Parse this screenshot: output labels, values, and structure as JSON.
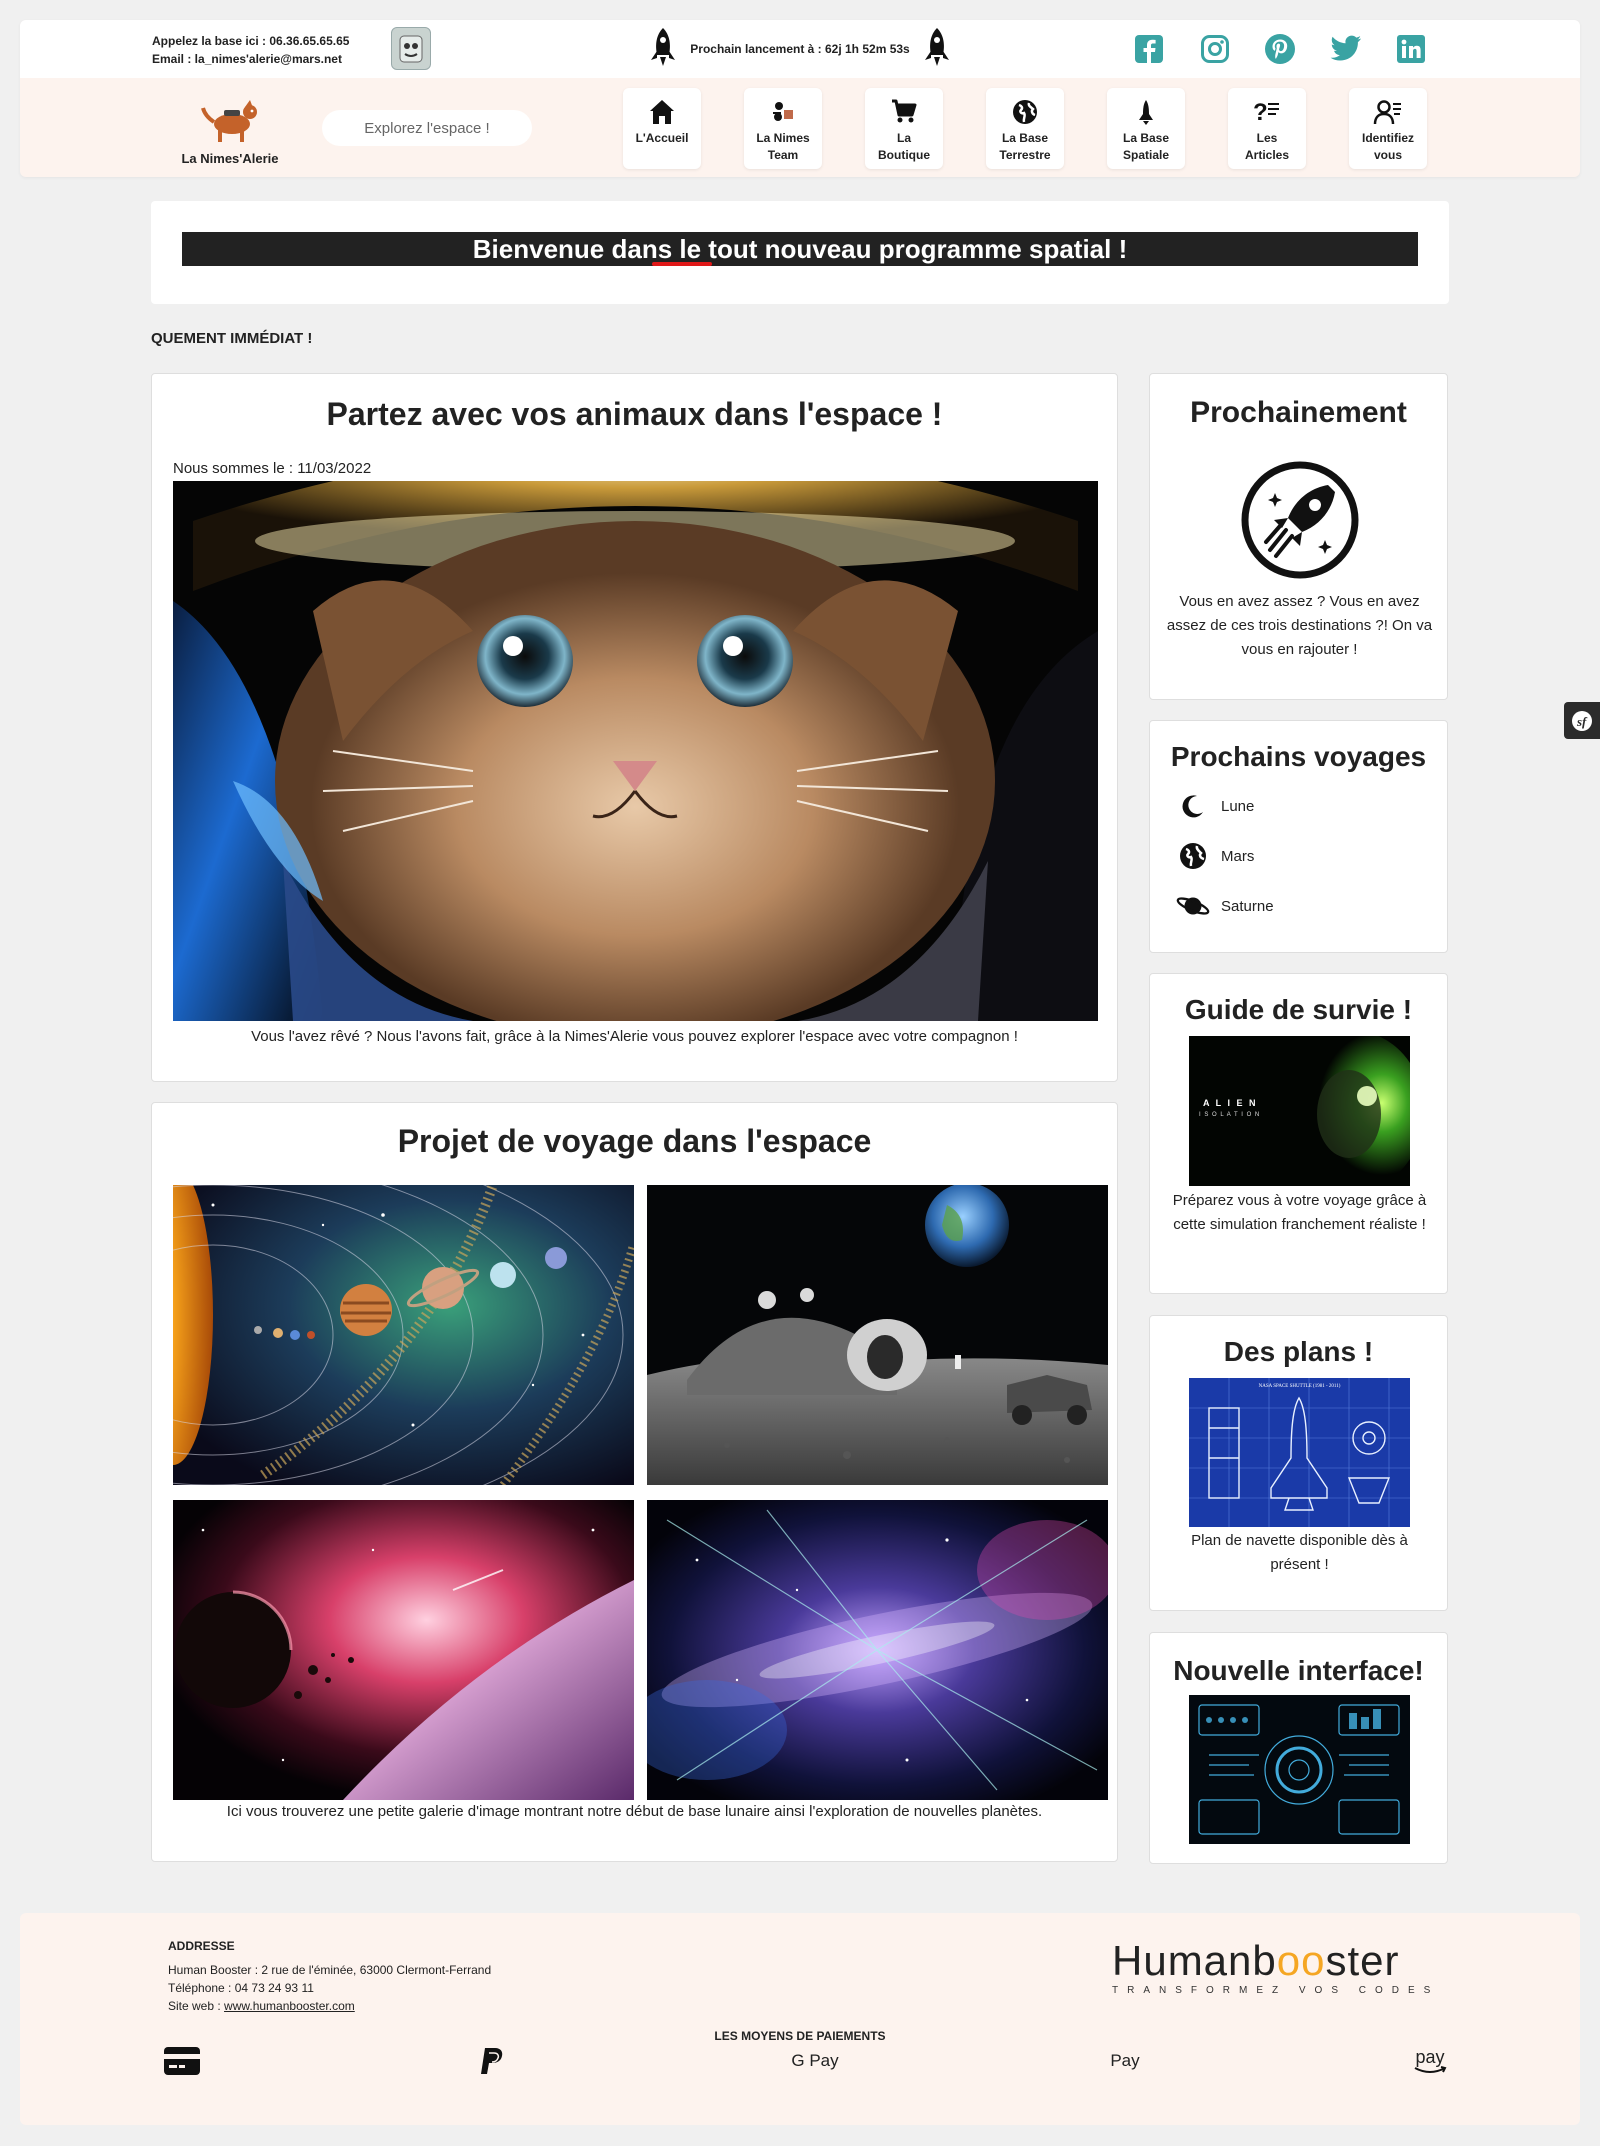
{
  "header": {
    "contact_phone": "Appelez la base ici : 06.36.65.65.65",
    "contact_email": "Email : la_nimes'alerie@mars.net",
    "launch_text": "Prochain lancement à : 62j 1h 52m 53s",
    "socials": [
      "facebook-icon",
      "instagram-icon",
      "pinterest-icon",
      "twitter-icon",
      "linkedin-icon"
    ],
    "logo_text": "La Nimes'Alerie",
    "search_placeholder": "Explorez l'espace !",
    "nav": [
      {
        "label": "L'Accueil",
        "icon": "home-icon"
      },
      {
        "label": "La Nimes\nTeam",
        "icon": "team-icon"
      },
      {
        "label": "La\nBoutique",
        "icon": "cart-icon"
      },
      {
        "label": "La Base\nTerrestre",
        "icon": "globe-icon"
      },
      {
        "label": "La Base\nSpatiale",
        "icon": "shuttle-icon"
      },
      {
        "label": "Les\nArticles",
        "icon": "articles-icon"
      },
      {
        "label": "Identifiez\nvous",
        "icon": "user-icon"
      }
    ]
  },
  "banner": {
    "text": "Bienvenue dans le tout nouveau programme spatial !"
  },
  "marquee": "QUEMENT IMMÉDIAT !",
  "main": {
    "pets": {
      "title": "Partez avec vos animaux dans l'espace !",
      "date": "Nous sommes le : 11/03/2022",
      "caption": "Vous l'avez rêvé ? Nous l'avons fait, grâce à la Nimes'Alerie vous pouvez explorer l'espace avec votre compagnon !"
    },
    "gallery": {
      "title": "Projet de voyage dans l'espace",
      "caption": "Ici vous trouverez une petite galerie d'image montrant notre début de base lunaire ainsi l'exploration de nouvelles planètes."
    }
  },
  "sidebar": {
    "soon": {
      "title": "Prochainement",
      "text": "Vous en avez assez ? Vous en avez assez de ces trois destinations ?! On va vous en rajouter !"
    },
    "trips": {
      "title": "Prochains voyages",
      "items": [
        "Lune",
        "Mars",
        "Saturne"
      ]
    },
    "guide": {
      "title": "Guide de survie !",
      "game_title": "A L I E N",
      "game_subtitle": "I S O L A T I O N",
      "text": "Préparez vous à votre voyage grâce à cette simulation franchement réaliste !"
    },
    "plans": {
      "title": "Des plans !",
      "blueprint_title": "NASA SPACE SHUTTLE (1981 - 2011)",
      "text": "Plan de navette disponible dès à présent !"
    },
    "interface": {
      "title": "Nouvelle interface!"
    }
  },
  "footer": {
    "address_heading": "ADDRESSE",
    "address_line": "Human Booster : 2 rue de l'éminée, 63000 Clermont-Ferrand",
    "phone_line": "Téléphone : 04 73 24 93 11",
    "site_prefix": "Site web : ",
    "site_link": "www.humanbooster.com",
    "brand_main_1": "Human",
    "brand_main_2": "b",
    "brand_main_3": "oo",
    "brand_main_4": "ster",
    "brand_tag": "TRANSFORMEZ VOS CODES",
    "payments_heading": "LES MOYENS DE PAIEMENTS",
    "payments": [
      "credit-card-icon",
      "paypal-icon",
      "G Pay",
      " Pay",
      "pay"
    ]
  },
  "colors": {
    "social": "#3aa3a3",
    "header_bg": "#fdf3ee",
    "banner_bar": "#222222",
    "accent_red": "#e01818",
    "brand_orange": "#f5a623"
  }
}
